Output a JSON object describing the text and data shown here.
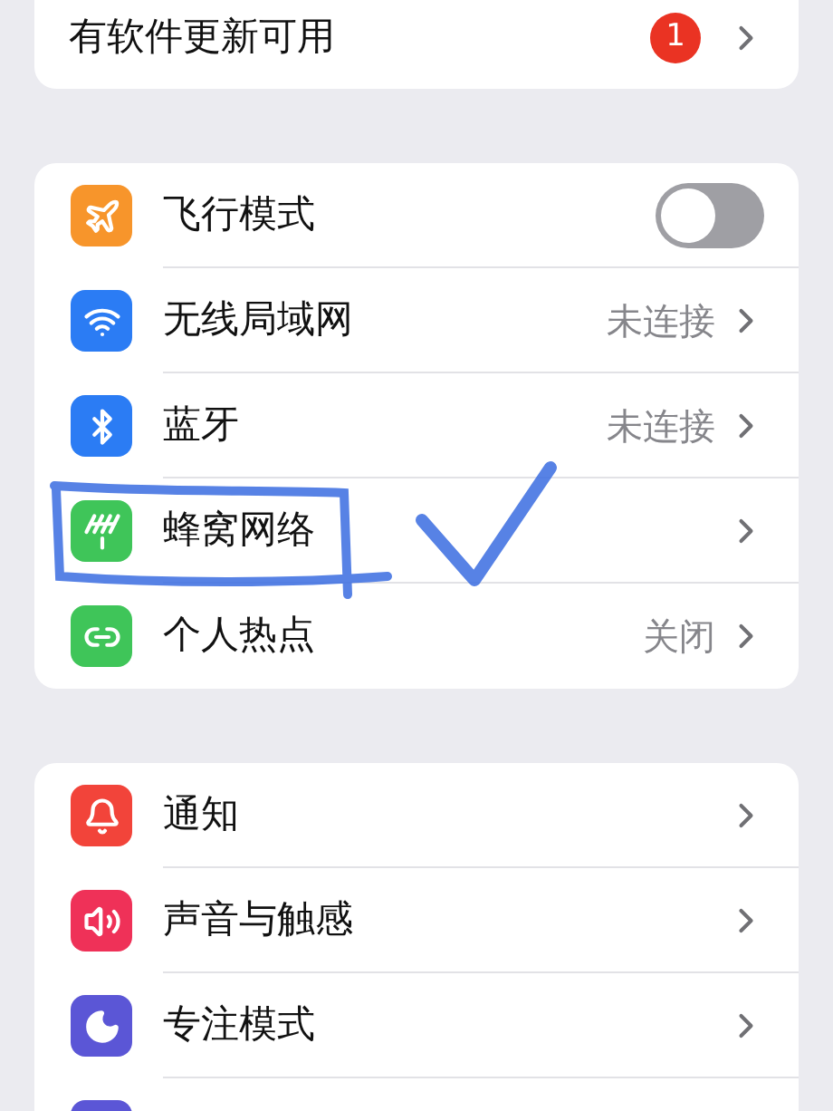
{
  "groups": [
    {
      "items": [
        {
          "kind": "link",
          "label": "有软件更新可用",
          "badge": "1"
        }
      ]
    },
    {
      "items": [
        {
          "kind": "toggle",
          "label": "飞行模式",
          "color": "#f7952b",
          "on": false
        },
        {
          "kind": "link",
          "label": "无线局域网",
          "color": "#2b7cf4",
          "value": "未连接"
        },
        {
          "kind": "link",
          "label": "蓝牙",
          "color": "#2b7cf4",
          "value": "未连接"
        },
        {
          "kind": "link",
          "label": "蜂窝网络",
          "color": "#3fc559"
        },
        {
          "kind": "link",
          "label": "个人热点",
          "color": "#3fc559",
          "value": "关闭"
        }
      ]
    },
    {
      "items": [
        {
          "kind": "link",
          "label": "通知",
          "color": "#f2443a"
        },
        {
          "kind": "link",
          "label": "声音与触感",
          "color": "#ef3158"
        },
        {
          "kind": "link",
          "label": "专注模式",
          "color": "#5b56d6"
        },
        {
          "kind": "partial",
          "color": "#5b56d6"
        }
      ]
    }
  ]
}
